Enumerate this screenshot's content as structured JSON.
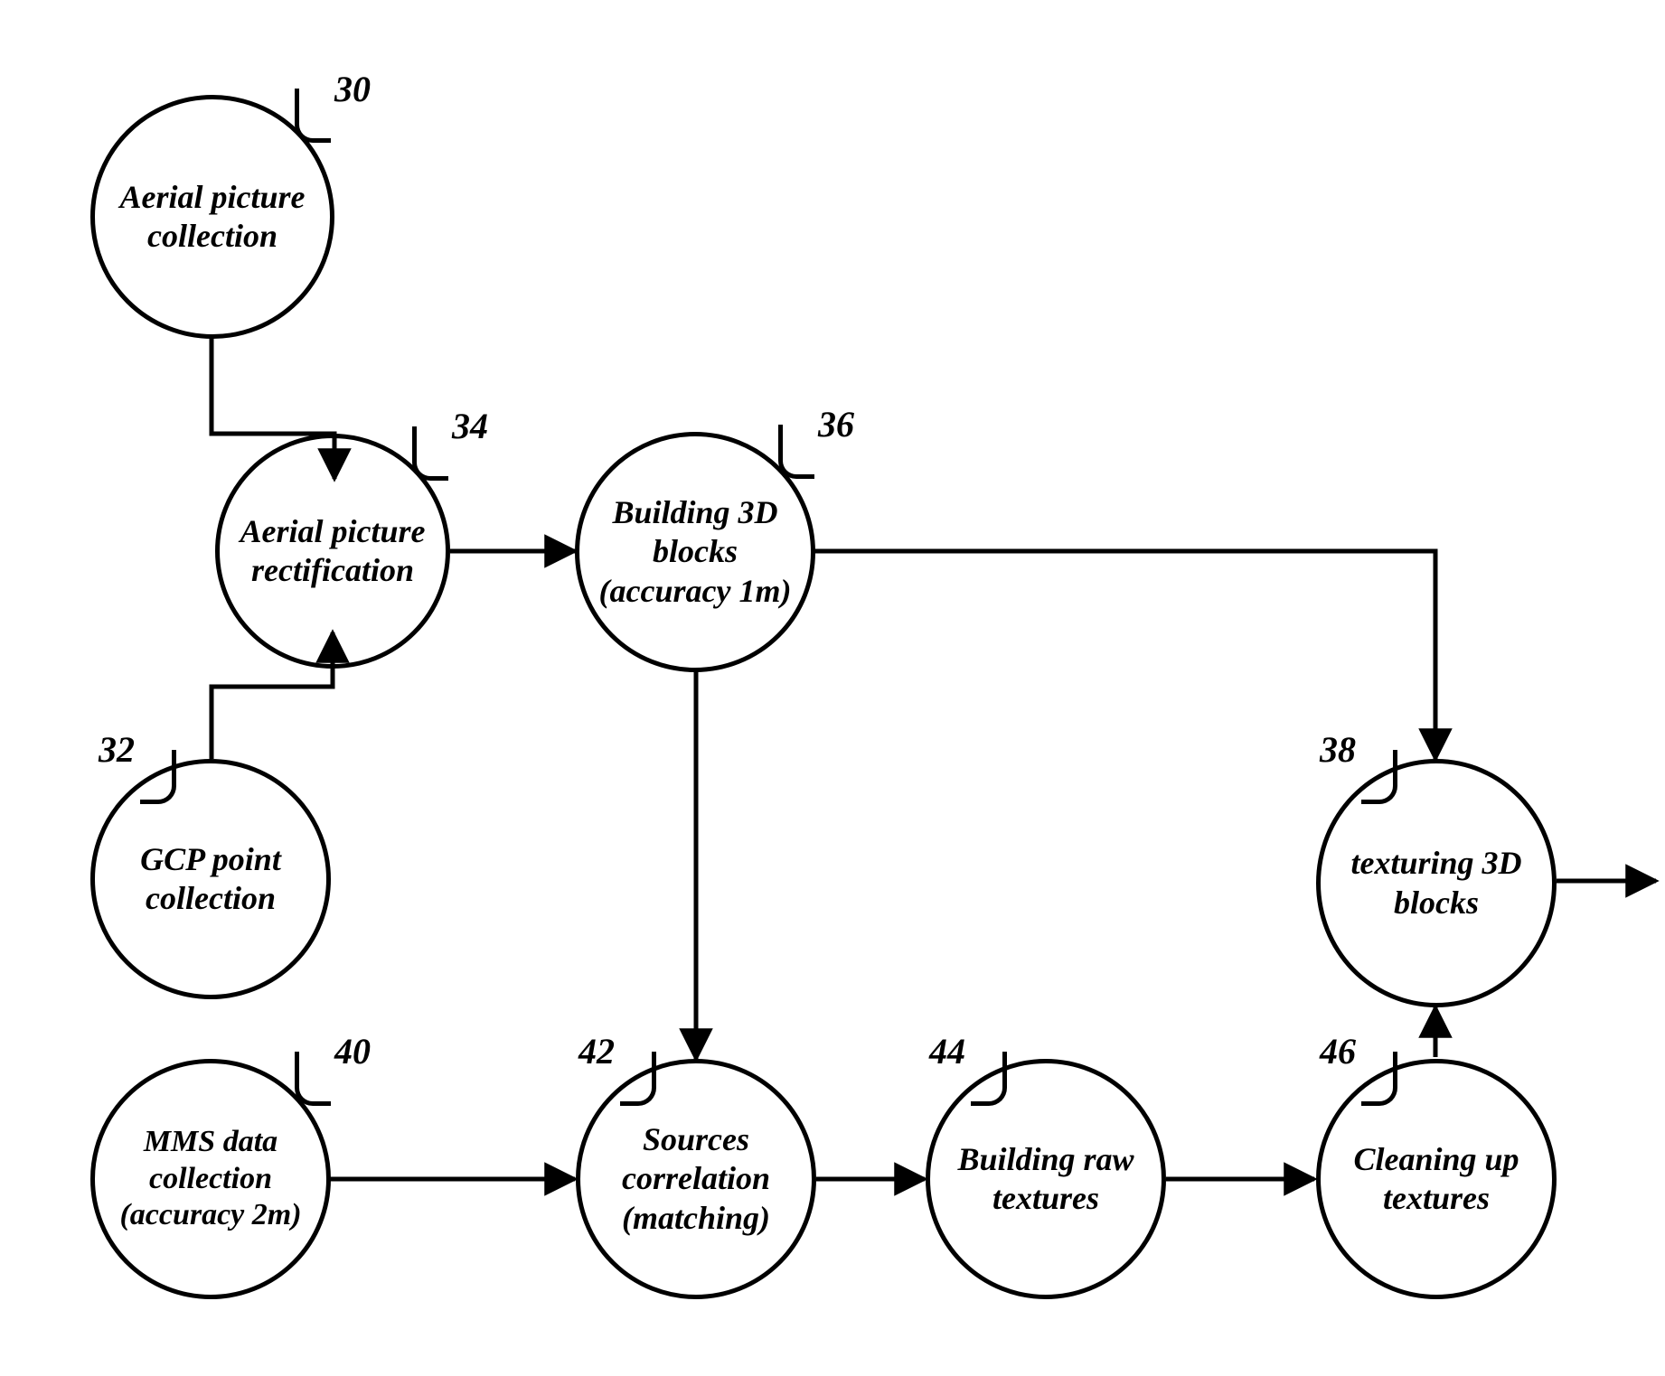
{
  "diagram": {
    "nodes": {
      "n30": {
        "ref": "30",
        "label": "Aerial picture collection"
      },
      "n32": {
        "ref": "32",
        "label": "GCP point collection"
      },
      "n34": {
        "ref": "34",
        "label": "Aerial picture rectification"
      },
      "n36": {
        "ref": "36",
        "label": "Building 3D blocks (accuracy 1m)"
      },
      "n38": {
        "ref": "38",
        "label": "texturing 3D blocks"
      },
      "n40": {
        "ref": "40",
        "label": "MMS data collection (accuracy 2m)"
      },
      "n42": {
        "ref": "42",
        "label": "Sources correlation (matching)"
      },
      "n44": {
        "ref": "44",
        "label": "Building raw textures"
      },
      "n46": {
        "ref": "46",
        "label": "Cleaning up textures"
      }
    },
    "edges": [
      {
        "from": "n30",
        "to": "n34"
      },
      {
        "from": "n32",
        "to": "n34"
      },
      {
        "from": "n34",
        "to": "n36"
      },
      {
        "from": "n36",
        "to": "n38"
      },
      {
        "from": "n36",
        "to": "n42"
      },
      {
        "from": "n40",
        "to": "n42"
      },
      {
        "from": "n42",
        "to": "n44"
      },
      {
        "from": "n44",
        "to": "n46"
      },
      {
        "from": "n46",
        "to": "n38"
      },
      {
        "from": "n38",
        "to": "output"
      }
    ]
  }
}
